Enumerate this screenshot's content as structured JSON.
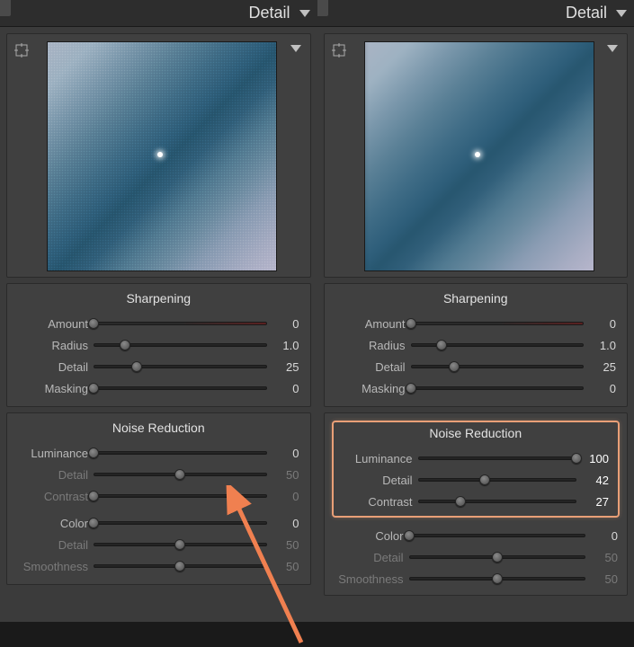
{
  "left": {
    "title": "Detail",
    "sharpening": {
      "title": "Sharpening",
      "amount": {
        "label": "Amount",
        "value": "0",
        "pos": 0,
        "style": "redtint"
      },
      "radius": {
        "label": "Radius",
        "value": "1.0",
        "pos": 18
      },
      "detail": {
        "label": "Detail",
        "value": "25",
        "pos": 25
      },
      "masking": {
        "label": "Masking",
        "value": "0",
        "pos": 0
      }
    },
    "noise": {
      "title": "Noise Reduction",
      "luminance": {
        "label": "Luminance",
        "value": "0",
        "pos": 0
      },
      "detail": {
        "label": "Detail",
        "value": "50",
        "pos": 50,
        "dim": true
      },
      "contrast": {
        "label": "Contrast",
        "value": "0",
        "pos": 0,
        "dim": true
      }
    },
    "color": {
      "color": {
        "label": "Color",
        "value": "0",
        "pos": 0,
        "style": "hue"
      },
      "detail": {
        "label": "Detail",
        "value": "50",
        "pos": 50,
        "dim": true
      },
      "smoothness": {
        "label": "Smoothness",
        "value": "50",
        "pos": 50,
        "dim": true
      }
    }
  },
  "right": {
    "title": "Detail",
    "sharpening": {
      "title": "Sharpening",
      "amount": {
        "label": "Amount",
        "value": "0",
        "pos": 0,
        "style": "redtint"
      },
      "radius": {
        "label": "Radius",
        "value": "1.0",
        "pos": 18
      },
      "detail": {
        "label": "Detail",
        "value": "25",
        "pos": 25
      },
      "masking": {
        "label": "Masking",
        "value": "0",
        "pos": 0
      }
    },
    "noise": {
      "title": "Noise Reduction",
      "luminance": {
        "label": "Luminance",
        "value": "100",
        "pos": 100,
        "bright": true
      },
      "detail": {
        "label": "Detail",
        "value": "42",
        "pos": 42,
        "bright": true
      },
      "contrast": {
        "label": "Contrast",
        "value": "27",
        "pos": 27,
        "bright": true
      }
    },
    "color": {
      "color": {
        "label": "Color",
        "value": "0",
        "pos": 0,
        "style": "hue"
      },
      "detail": {
        "label": "Detail",
        "value": "50",
        "pos": 50,
        "dim": true
      },
      "smoothness": {
        "label": "Smoothness",
        "value": "50",
        "pos": 50,
        "dim": true
      }
    }
  }
}
